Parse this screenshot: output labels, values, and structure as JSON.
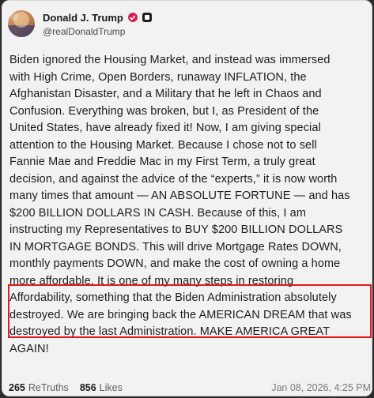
{
  "post": {
    "author": {
      "display_name": "Donald J. Trump",
      "handle": "@realDonaldTrump",
      "verified_badge_color": "#d6204d"
    },
    "text_lines": [
      "Biden ignored the Housing Market, and instead was immersed",
      "with High Crime, Open Borders, runaway INFLATION, the",
      "Afghanistan Disaster, and a Military that he left in Chaos and",
      "Confusion. Everything was broken, but I, as President of the",
      "United States, have already fixed it! Now, I am giving special",
      "attention to the Housing Market. Because I chose not to sell",
      "Fannie Mae and Freddie Mac in my First Term, a truly great",
      "decision, and against the advice of the “experts,” it is now worth",
      "many times that amount — AN ABSOLUTE FORTUNE — and has",
      "$200 BILLION DOLLARS IN CASH. Because of this, I am",
      "instructing my Representatives to BUY $200 BILLION DOLLARS",
      "IN MORTGAGE BONDS. This will drive Mortgage Rates DOWN,",
      "monthly payments DOWN, and make the cost of owning a home",
      "more affordable. It is one of my many steps in restoring",
      "Affordability, something that the Biden Administration absolutely",
      "destroyed. We are bringing back the AMERICAN DREAM that was",
      "destroyed by the last Administration. MAKE AMERICA GREAT",
      "AGAIN!"
    ],
    "stats": {
      "retruths_count": "265",
      "retruths_label": "ReTruths",
      "likes_count": "856",
      "likes_label": "Likes"
    },
    "timestamp": "Jan 08, 2026, 4:25 PM",
    "highlight_color": "#e11b1b"
  }
}
